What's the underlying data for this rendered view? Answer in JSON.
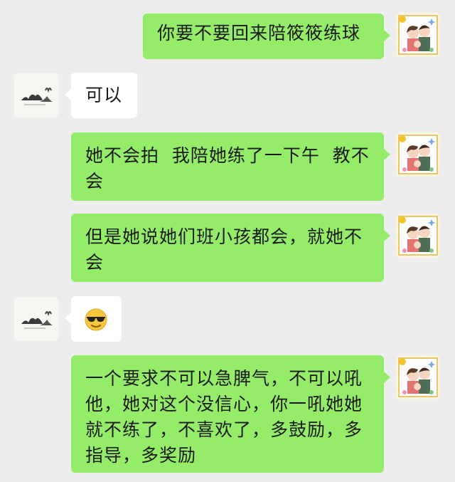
{
  "messages": [
    {
      "sender": "self",
      "text": "你要不要回来陪筱筱练球"
    },
    {
      "sender": "other",
      "text": "可以"
    },
    {
      "sender": "self",
      "text": "她不会拍  我陪她练了一下午  教不会"
    },
    {
      "sender": "self",
      "text": "但是她说她们班小孩都会，就她不会"
    },
    {
      "sender": "other",
      "emoji": "smiling-face-with-sunglasses"
    },
    {
      "sender": "self",
      "text": "一个要求不可以急脾气，不可以吼他，她对这个没信心，你一吼她她就不练了，不喜欢了，多鼓励，多指导，多奖励"
    }
  ],
  "colors": {
    "background": "#ededed",
    "self_bubble": "#95ec69",
    "other_bubble": "#ffffff"
  }
}
